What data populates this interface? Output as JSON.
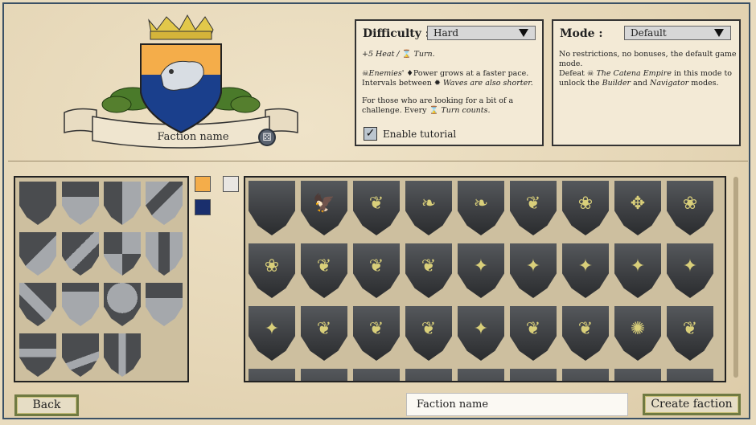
{
  "crest": {
    "faction_name": "Faction name",
    "colors": {
      "primary": "#f4ad4a",
      "secondary": "#1a3f8c",
      "laurel": "#4a7a2a",
      "crown": "#e2c84a"
    },
    "dice_icon": "dice-icon"
  },
  "difficulty": {
    "label": "Difficulty :",
    "selected": "Hard",
    "line1_a": "+5 Heat / ",
    "line1_b": "Turn.",
    "line2_a": "Enemies' ",
    "line2_b": "Power grows at a faster pace. Intervals between ",
    "line2_c": "Waves are also shorter.",
    "line3": "For those who are looking for a bit of a challenge. Every ",
    "line3_b": "Turn counts.",
    "tutorial_label": "Enable tutorial",
    "tutorial_checked": true
  },
  "mode": {
    "label": "Mode :",
    "selected": "Default",
    "line1": "No restrictions, no bonuses, the default game mode.",
    "line2_a": "Defeat ",
    "line2_b": "The Catena Empire",
    "line2_c": " in this mode to unlock the ",
    "line2_d": "Builder",
    "line2_e": " and ",
    "line2_f": "Navigator",
    "line2_g": " modes."
  },
  "swatches": {
    "orange": "#f4ad4a",
    "light": "#e9e6e2",
    "navy": "#1a2f6d"
  },
  "emblems": [
    [
      "blank",
      "eagle",
      "griffin",
      "wing",
      "wings",
      "feather",
      "swan",
      "claw",
      "heron"
    ],
    [
      "bird",
      "griffin-head",
      "dragon-head",
      "fish-bird",
      "hound",
      "dog",
      "wolf",
      "fox",
      "deer"
    ],
    [
      "stag",
      "horse-head",
      "dragon",
      "serpent",
      "elephant",
      "beast-head",
      "lion-head",
      "lion-face",
      "seahorse"
    ]
  ],
  "footer": {
    "back_label": "Back",
    "name_value": "Faction name",
    "create_label": "Create faction"
  }
}
